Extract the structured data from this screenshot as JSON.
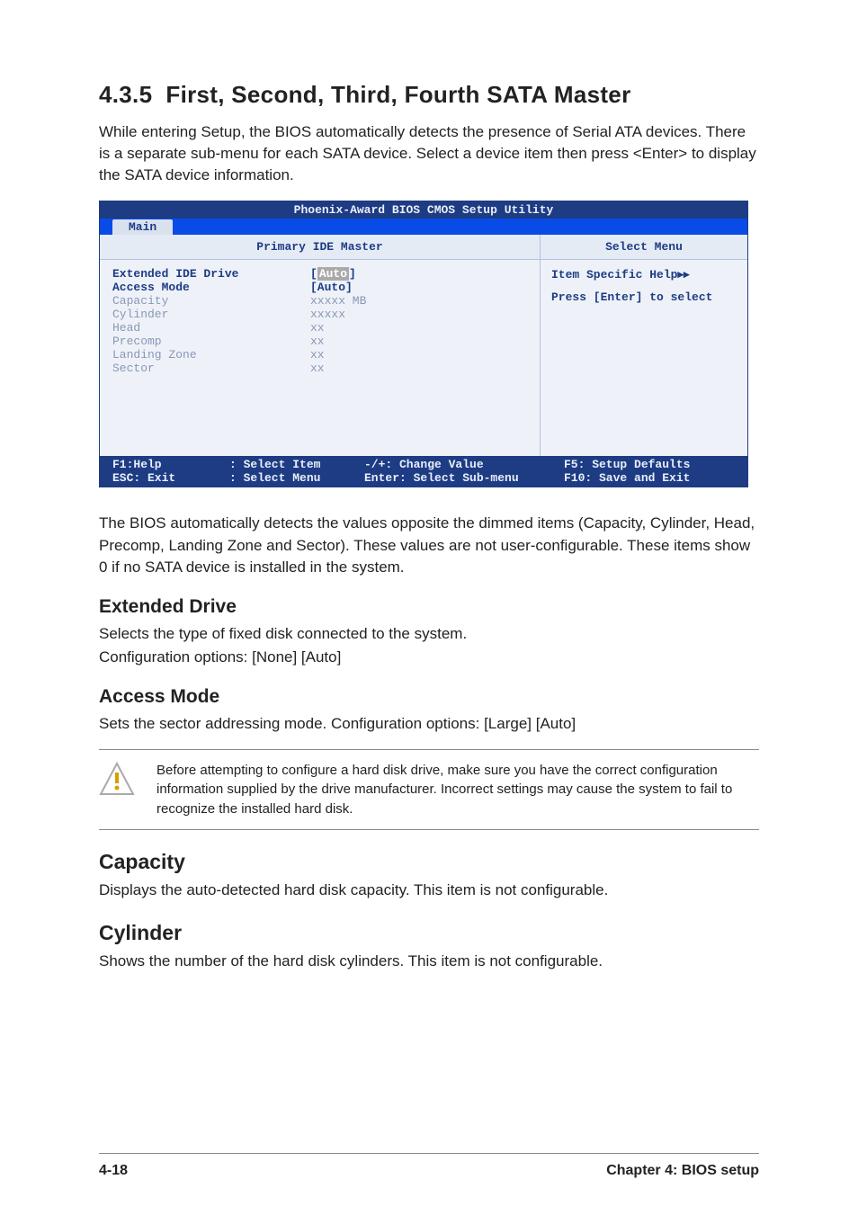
{
  "section": {
    "number": "4.3.5",
    "title": "First, Second, Third, Fourth SATA Master",
    "intro": "While entering Setup, the BIOS automatically detects the presence of Serial ATA devices. There is a separate sub-menu for each SATA device. Select a device item then press <Enter> to display the SATA device information."
  },
  "bios": {
    "utility_title": "Phoenix-Award BIOS CMOS Setup Utility",
    "tab": "Main",
    "left_header": "Primary IDE Master",
    "right_header": "Select Menu",
    "rows": [
      {
        "label": "Extended IDE Drive",
        "value": "[Auto]",
        "highlight": true,
        "active": true
      },
      {
        "label": "Access Mode",
        "value": "[Auto]",
        "active": true
      },
      {
        "label": "",
        "value": ""
      },
      {
        "label": "Capacity",
        "value": "xxxxx MB",
        "dim": true
      },
      {
        "label": "",
        "value": ""
      },
      {
        "label": "Cylinder",
        "value": "xxxxx",
        "dim": true
      },
      {
        "label": "Head",
        "value": "   xx",
        "dim": true
      },
      {
        "label": "Precomp",
        "value": "   xx",
        "dim": true
      },
      {
        "label": "Landing Zone",
        "value": "   xx",
        "dim": true
      },
      {
        "label": "Sector",
        "value": "   xx",
        "dim": true
      }
    ],
    "help1": "Item Specific Help",
    "help2": "Press [Enter] to select",
    "footer": {
      "f1": "F1:Help",
      "esc": "ESC: Exit",
      "sel_item": ": Select Item",
      "sel_menu": ": Select Menu",
      "change": "-/+:  Change Value",
      "enter": "Enter: Select Sub-menu",
      "f5": "F5: Setup Defaults",
      "f10": "F10: Save and Exit"
    }
  },
  "after_bios": "The BIOS automatically detects the values opposite the dimmed items (Capacity, Cylinder,  Head, Precomp, Landing Zone and Sector). These values are not user-configurable. These items show 0 if no SATA device is installed in the system.",
  "ext_drive": {
    "heading": "Extended Drive",
    "line1": "Selects the type of fixed disk connected to the system.",
    "line2": "Configuration options: [None] [Auto]"
  },
  "access_mode": {
    "heading": "Access Mode",
    "line": "Sets the sector addressing mode. Configuration options: [Large] [Auto]"
  },
  "note": "Before attempting to configure a hard disk drive, make sure you have the correct configuration information supplied by the drive manufacturer. Incorrect settings may cause the system to fail to recognize the installed hard disk.",
  "capacity": {
    "heading": "Capacity",
    "text": "Displays the auto-detected hard disk capacity. This item is not configurable."
  },
  "cylinder": {
    "heading": "Cylinder",
    "text": "Shows the number of the hard disk cylinders. This item is not configurable."
  },
  "footer": {
    "page": "4-18",
    "chapter": "Chapter 4: BIOS setup"
  }
}
